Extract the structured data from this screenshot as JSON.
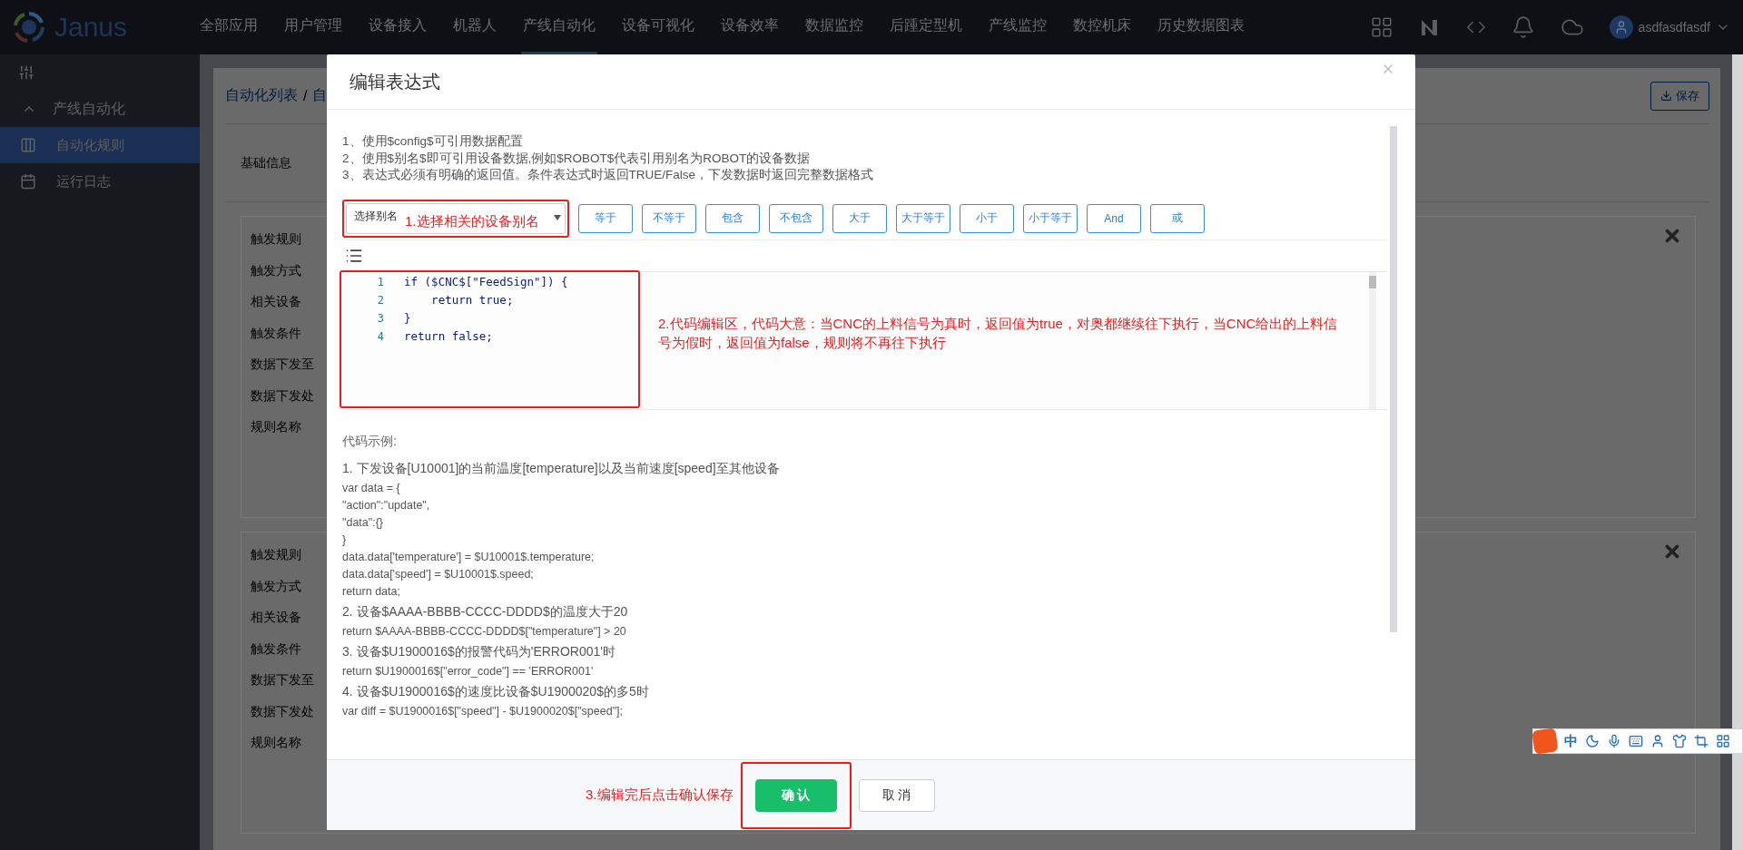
{
  "app": {
    "logo_text": "Janus"
  },
  "nav": [
    {
      "label": "全部应用",
      "selected": false
    },
    {
      "label": "用户管理",
      "selected": false
    },
    {
      "label": "设备接入",
      "selected": false
    },
    {
      "label": "机器人",
      "selected": false
    },
    {
      "label": "产线自动化",
      "selected": true
    },
    {
      "label": "设备可视化",
      "selected": false
    },
    {
      "label": "设备效率",
      "selected": false
    },
    {
      "label": "数据监控",
      "selected": false
    },
    {
      "label": "后踵定型机",
      "selected": false
    },
    {
      "label": "产线监控",
      "selected": false
    },
    {
      "label": "数控机床",
      "selected": false
    },
    {
      "label": "历史数据图表",
      "selected": false
    }
  ],
  "user": {
    "name": "asdfasdfasdf"
  },
  "sidebar": {
    "group": {
      "label": "产线自动化",
      "expanded": true
    },
    "items": [
      {
        "label": "自动化规则",
        "selected": true,
        "kind": "rules"
      },
      {
        "label": "运行日志",
        "selected": false,
        "kind": "log"
      }
    ]
  },
  "page": {
    "breadcrumb": [
      "自动化列表",
      "自"
    ],
    "breadcrumb_separator": "/",
    "save_button": "保存",
    "tabs": [
      "基础信息"
    ],
    "cards": [
      {
        "labels": [
          "触发规则",
          "触发方式",
          "相关设备",
          "触发条件",
          "数据下发至",
          "数据下发处",
          "规则名称"
        ]
      },
      {
        "labels": [
          "触发规则",
          "触发方式",
          "相关设备",
          "触发条件",
          "数据下发至",
          "数据下发处",
          "规则名称"
        ]
      }
    ]
  },
  "modal": {
    "title": "编辑表达式",
    "notes": [
      "1、使用$config$可引用数据配置",
      "2、使用$别名$即可引用设备数据,例如$ROBOT$代表引用别名为ROBOT的设备数据",
      "3、表达式必须有明确的返回值。条件表达式时返回TRUE/False，下发数据时返回完整数据格式"
    ],
    "alias_select": {
      "placeholder": "选择别名",
      "annotation": "1.选择相关的设备别名"
    },
    "operators": [
      "等于",
      "不等于",
      "包含",
      "不包含",
      "大于",
      "大于等于",
      "小于",
      "小于等于",
      "And",
      "或"
    ],
    "editor": {
      "lines": [
        {
          "number": "1",
          "text": "if ($CNC$[\"FeedSign\"]) {"
        },
        {
          "number": "2",
          "text": "    return true;"
        },
        {
          "number": "3",
          "text": "}"
        },
        {
          "number": "4",
          "text": "return false;"
        }
      ],
      "annotation": "2.代码编辑区，代码大意：当CNC的上料信号为真时，返回值为true，对奥都继续往下执行，当CNC给出的上料信号为假时，返回值为false，规则将不再往下执行"
    },
    "examples_title": "代码示例:",
    "examples": [
      {
        "kind": "heading",
        "text": "1. 下发设备[U10001]的当前温度[temperature]以及当前速度[speed]至其他设备"
      },
      {
        "kind": "code",
        "text": "var data = {"
      },
      {
        "kind": "code",
        "text": "\"action\":\"update\","
      },
      {
        "kind": "code",
        "text": "\"data\":{}"
      },
      {
        "kind": "code",
        "text": "}"
      },
      {
        "kind": "code",
        "text": "data.data['temperature'] = $U10001$.temperature;"
      },
      {
        "kind": "code",
        "text": "data.data['speed'] = $U10001$.speed;"
      },
      {
        "kind": "code",
        "text": "return data;"
      },
      {
        "kind": "heading",
        "text": "2. 设备$AAAA-BBBB-CCCC-DDDD$的温度大于20"
      },
      {
        "kind": "code",
        "text": "return $AAAA-BBBB-CCCC-DDDD$[\"temperature\"] > 20"
      },
      {
        "kind": "heading",
        "text": "3. 设备$U1900016$的报警代码为'ERROR001'时"
      },
      {
        "kind": "code",
        "text": "return $U1900016$[\"error_code\"] == 'ERROR001'"
      },
      {
        "kind": "heading",
        "text": "4. 设备$U1900016$的速度比设备$U1900020$的多5时"
      },
      {
        "kind": "code",
        "text": "var diff = $U1900016$[\"speed\"] - $U1900020$[\"speed\"];"
      }
    ],
    "footer": {
      "annotation": "3.编辑完后点击确认保存",
      "buttons": [
        {
          "label": "确 认",
          "kind": "primary"
        },
        {
          "label": "取 消",
          "kind": "default"
        }
      ]
    }
  },
  "ime_toolbar": {
    "mode": "中"
  }
}
